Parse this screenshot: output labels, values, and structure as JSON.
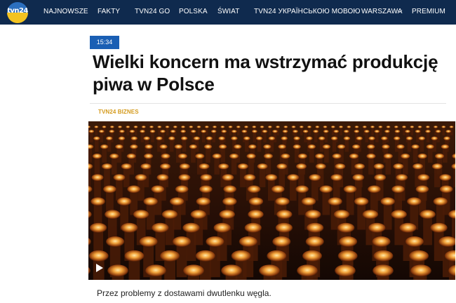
{
  "site": {
    "logo_text": "tvn24",
    "accent_color": "#0f2a4e",
    "nav": [
      {
        "label": "NAJNOWSZE"
      },
      {
        "label": "FAKTY"
      },
      {
        "label": "TVN24 GO"
      },
      {
        "label": "POLSKA"
      },
      {
        "label": "ŚWIAT"
      },
      {
        "label": "TVN24 УКРАЇНСЬКОЮ МОВОЮ"
      },
      {
        "label": "WARSZAWA"
      },
      {
        "label": "PREMIUM"
      }
    ]
  },
  "article": {
    "time": "15:34",
    "title": "Wielki koncern ma wstrzymać produkcję piwa w Polsce",
    "section": "TVN24 BIZNES",
    "section_color": "#d49a1c",
    "image_icon": "play-icon",
    "lead": "Przez problemy z dostawami dwutlenku węgla."
  }
}
